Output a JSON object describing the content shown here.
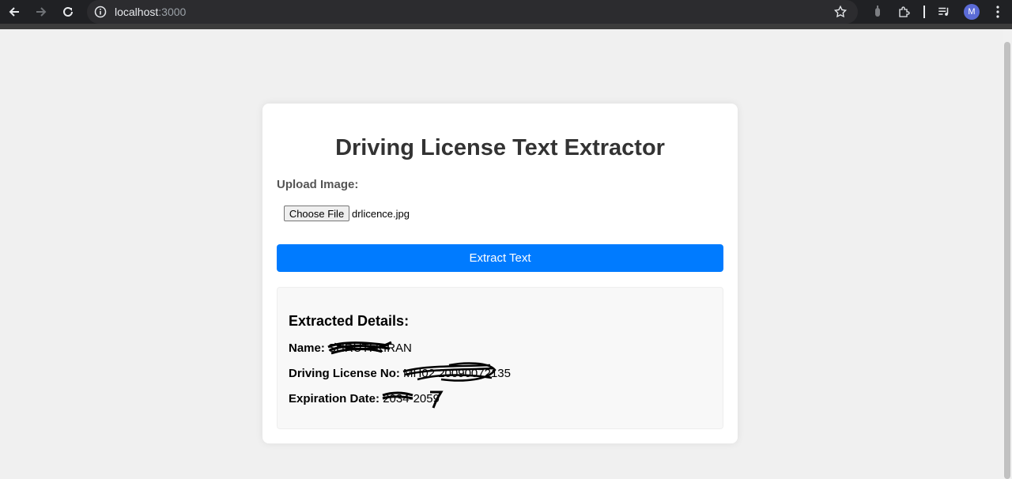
{
  "browser": {
    "url_host": "localhost",
    "url_port": ":3000",
    "profile_initial": "M"
  },
  "page": {
    "title": "Driving License Text Extractor",
    "upload_label": "Upload Image:",
    "choose_file_label": "Choose File",
    "selected_file": "drlicence.jpg",
    "extract_button_label": "Extract Text",
    "details": {
      "heading": "Extracted Details:",
      "name_label": "Name:",
      "name_value": "SHRUTI KIRAN",
      "license_label": "Driving License No:",
      "license_value": "MH02 20090072135",
      "expiration_label": "Expiration Date:",
      "expiration_value": "2034-2059"
    }
  },
  "colors": {
    "primary": "#007bff",
    "page_bg": "#f0f0f0",
    "chrome_bg": "#202124"
  }
}
